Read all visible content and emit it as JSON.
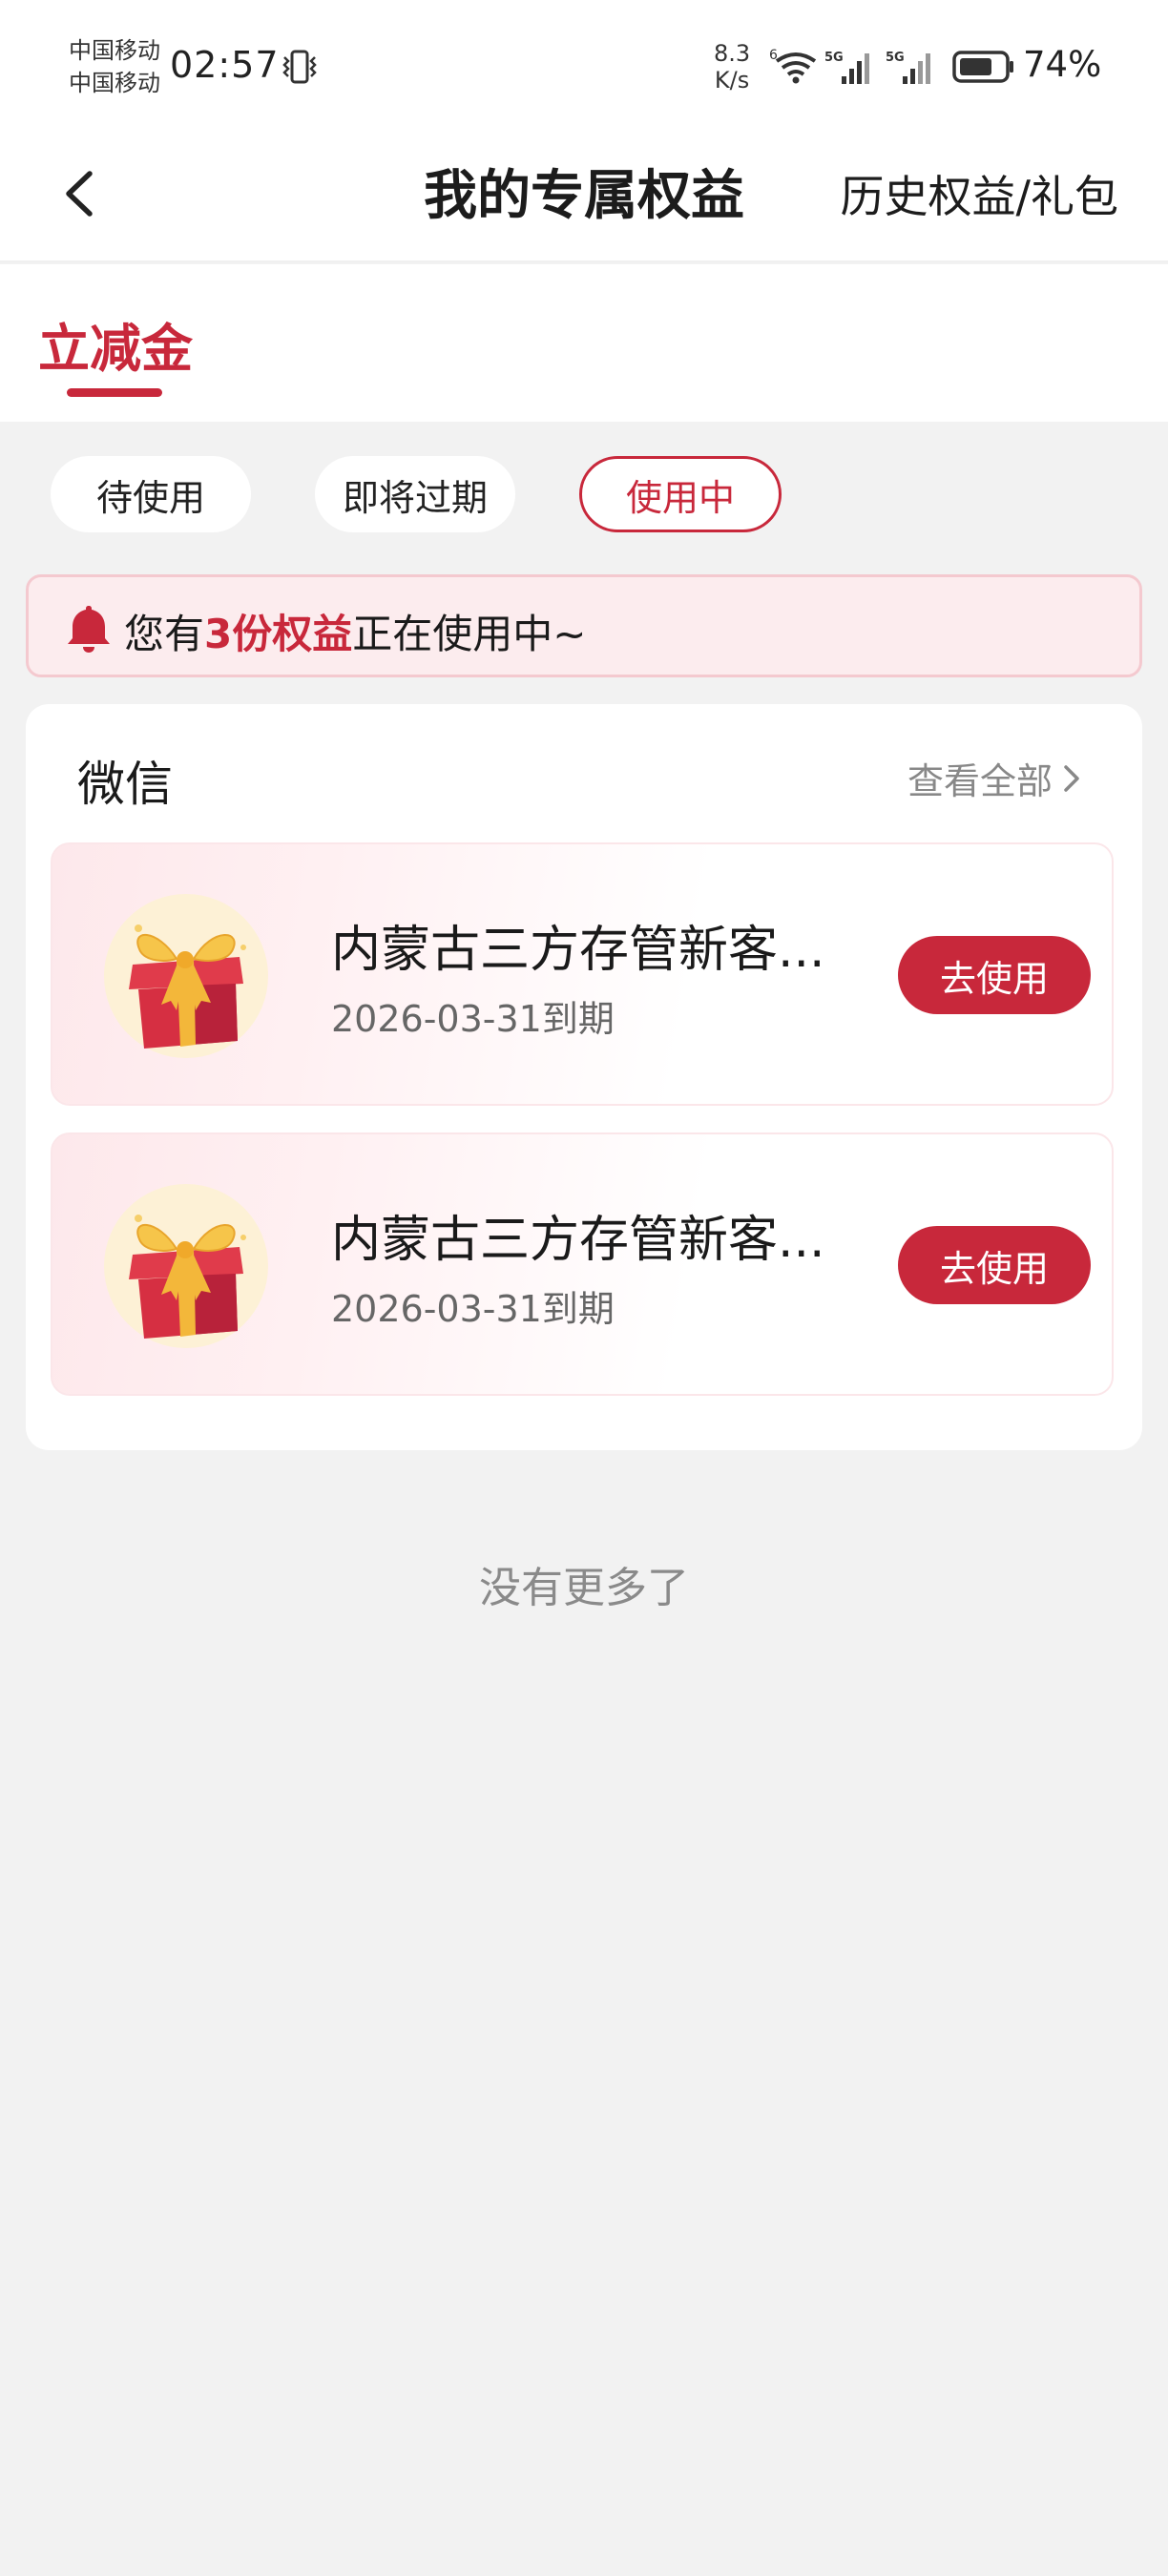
{
  "status_bar": {
    "carrier_1": "中国移动",
    "carrier_2": "中国移动",
    "time": "02:57",
    "net_speed_value": "8.3",
    "net_speed_unit": "K/s",
    "battery_percent": "74%",
    "battery_level": 0.74,
    "signal_label": "5G",
    "wifi_label": "6"
  },
  "nav": {
    "title": "我的专属权益",
    "history_link": "历史权益/礼包"
  },
  "tabs": [
    {
      "label": "立减金",
      "active": true
    }
  ],
  "filters": [
    {
      "label": "待使用",
      "active": false
    },
    {
      "label": "即将过期",
      "active": false
    },
    {
      "label": "使用中",
      "active": true
    }
  ],
  "notice": {
    "prefix": "您有",
    "highlight": "3份权益",
    "suffix": "正在使用中~"
  },
  "section": {
    "title": "微信",
    "view_all": "查看全部"
  },
  "items": [
    {
      "name": "内蒙古三方存管新客...",
      "expiry": "2026-03-31到期",
      "button": "去使用"
    },
    {
      "name": "内蒙古三方存管新客...",
      "expiry": "2026-03-31到期",
      "button": "去使用"
    }
  ],
  "footer": {
    "no_more": "没有更多了"
  },
  "colors": {
    "accent": "#c8283b",
    "page_bg": "#f2f2f2",
    "notice_bg": "#fcecee"
  }
}
